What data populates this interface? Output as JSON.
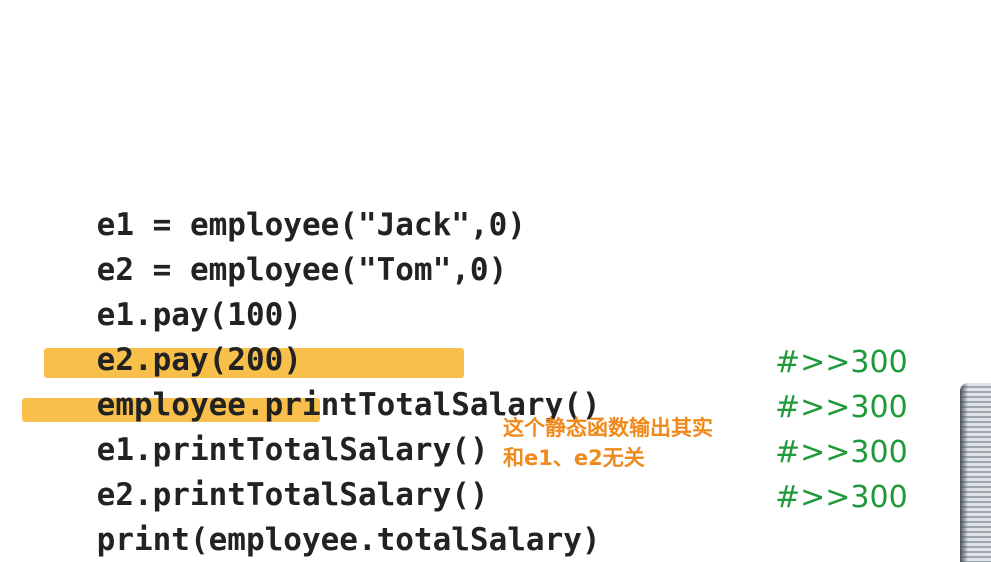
{
  "code_lines": [
    {
      "text": "e1 = employee(\"Jack\",0)",
      "comment": ""
    },
    {
      "text": "e2 = employee(\"Tom\",0)",
      "comment": ""
    },
    {
      "text": "e1.pay(100)",
      "comment": ""
    },
    {
      "text": "e2.pay(200)",
      "comment": ""
    },
    {
      "text": "employee.printTotalSalary()",
      "comment": "#>>300"
    },
    {
      "text": "e1.printTotalSalary()",
      "comment": "#>>300"
    },
    {
      "text": "e2.printTotalSalary()",
      "comment": "#>>300"
    },
    {
      "text": "print(employee.totalSalary)",
      "comment": "#>>300"
    }
  ],
  "annotation": {
    "line1": "这个静态函数输出其实",
    "line2": "和e1、e2无关"
  },
  "colors": {
    "code": "#222222",
    "comment": "#1f9a3a",
    "highlight": "#f7b52c",
    "annotation": "#f08a1c"
  }
}
